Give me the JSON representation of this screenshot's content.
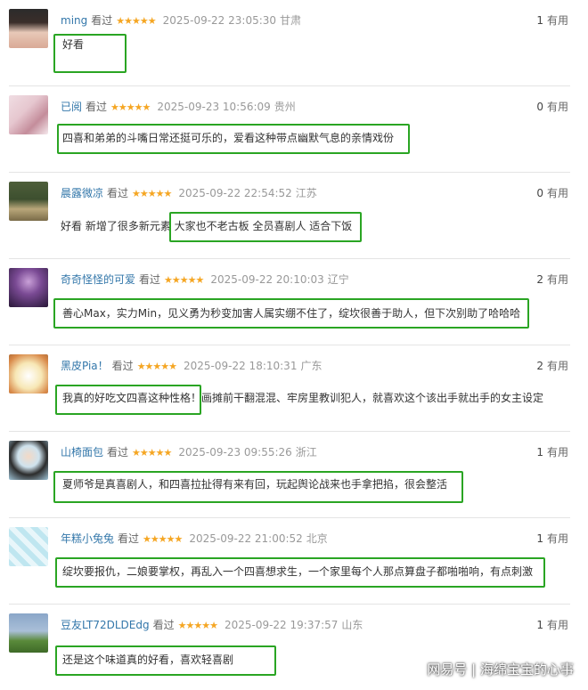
{
  "reviews": [
    {
      "user": "ming",
      "watched": "看过",
      "stars": "★★★★★",
      "time": "2025-09-22 23:05:30",
      "loc": "甘肃",
      "useful_count": "1",
      "useful_label": "有用",
      "text": "好看",
      "avatar_colors": [
        "#2b2b2b",
        "#e8c9b8"
      ]
    },
    {
      "user": "已阅",
      "watched": "看过",
      "stars": "★★★★★",
      "time": "2025-09-23 10:56:09",
      "loc": "贵州",
      "useful_count": "0",
      "useful_label": "有用",
      "text": "四喜和弟弟的斗嘴日常还挺可乐的，爱看这种带点幽默气息的亲情戏份",
      "avatar_colors": [
        "#f0dde3",
        "#c48d9b"
      ]
    },
    {
      "user": "晨露微凉",
      "watched": "看过",
      "stars": "★★★★★",
      "time": "2025-09-22 22:54:52",
      "loc": "江苏",
      "useful_count": "0",
      "useful_label": "有用",
      "text": "好看 新增了很多新元素 大家也不老古板 全员喜剧人 适合下饭",
      "avatar_colors": [
        "#3d4f2f",
        "#b9a77a"
      ]
    },
    {
      "user": "奇奇怪怪的可爱",
      "watched": "看过",
      "stars": "★★★★★",
      "time": "2025-09-22 20:10:03",
      "loc": "辽宁",
      "useful_count": "2",
      "useful_label": "有用",
      "text": "善心Max，实力Min，见义勇为秒变加害人属实绷不住了，绽坎很善于助人，但下次别助了哈哈哈",
      "avatar_colors": [
        "#4a2c5e",
        "#c9a0d8"
      ]
    },
    {
      "user": "黑皮Pia！",
      "watched": "看过",
      "stars": "★★★★★",
      "time": "2025-09-22 18:10:31",
      "loc": "广东",
      "useful_count": "2",
      "useful_label": "有用",
      "text": "我真的好吃文四喜这种性格！画摊前干翻混混、牢房里教训犯人，就喜欢这个该出手就出手的女主设定",
      "avatar_colors": [
        "#f7e7b5",
        "#d98a4a"
      ]
    },
    {
      "user": "山椅面包",
      "watched": "看过",
      "stars": "★★★★★",
      "time": "2025-09-23 09:55:26",
      "loc": "浙江",
      "useful_count": "1",
      "useful_label": "有用",
      "text": "夏师爷是真喜剧人，和四喜拉扯得有来有回，玩起舆论战来也手拿把掐，很会整活",
      "avatar_colors": [
        "#cfe3ee",
        "#2c2c2c"
      ]
    },
    {
      "user": "年糕小兔兔",
      "watched": "看过",
      "stars": "★★★★★",
      "time": "2025-09-22 21:00:52",
      "loc": "北京",
      "useful_count": "1",
      "useful_label": "有用",
      "text": "绽坎要报仇，二娘要掌权，再乱入一个四喜想求生，一个家里每个人那点算盘子都啪啪响，有点刺激",
      "avatar_colors": [
        "#bfe6f0",
        "#7fc4d9"
      ]
    },
    {
      "user": "豆友LT72DLDEdg",
      "watched": "看过",
      "stars": "★★★★★",
      "time": "2025-09-22 19:37:57",
      "loc": "山东",
      "useful_count": "1",
      "useful_label": "有用",
      "text": "还是这个味道真的好看，喜欢轻喜剧",
      "avatar_colors": [
        "#8aa6c8",
        "#5a8a3a"
      ]
    }
  ],
  "watermark": "网易号 | 海绵宝宝的心事",
  "highlight_color": "#2aa523"
}
